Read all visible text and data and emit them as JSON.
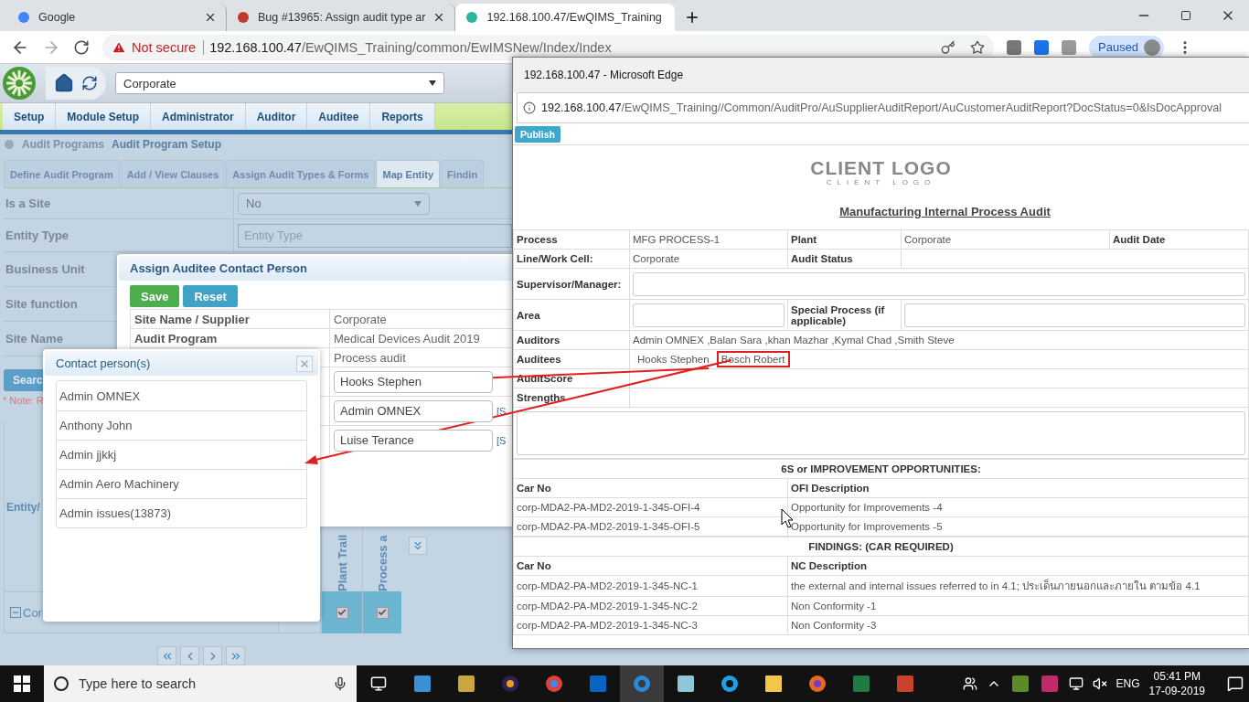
{
  "browser": {
    "tabs": [
      {
        "title": "Google",
        "selected": false
      },
      {
        "title": "Bug #13965: Assign audit type ar",
        "selected": false
      },
      {
        "title": "192.168.100.47/EwQIMS_Training",
        "selected": true
      }
    ],
    "address": {
      "security": "Not secure",
      "host": "192.168.100.47",
      "path": "/EwQIMS_Training/common/EwIMSNew/Index/Index"
    },
    "profile": "Paused"
  },
  "app": {
    "site_select": "Corporate",
    "menu": [
      "Setup",
      "Module Setup",
      "Administrator",
      "Auditor",
      "Auditee",
      "Reports"
    ],
    "breadcrumb": [
      "Audit Programs",
      "Audit Program Setup"
    ],
    "tabs": [
      {
        "label": "Define Audit Program",
        "selected": false
      },
      {
        "label": "Add / View Clauses",
        "selected": false
      },
      {
        "label": "Assign Audit Types & Forms",
        "selected": false
      },
      {
        "label": "Map Entity",
        "selected": true
      },
      {
        "label": "Findin",
        "selected": false
      }
    ],
    "form": [
      {
        "label": "Is a Site",
        "kind": "select",
        "value": "No"
      },
      {
        "label": "Entity Type",
        "kind": "input",
        "placeholder": "Entity Type"
      },
      {
        "label": "Business Unit",
        "kind": "empty"
      },
      {
        "label": "Site function",
        "kind": "empty"
      },
      {
        "label": "Site Name",
        "kind": "empty"
      }
    ],
    "search_button": "Searc",
    "note": "* Note: R",
    "entity_label": "Entity/",
    "grid": {
      "columns": [
        "Plant Trail",
        "Process a"
      ],
      "row": {
        "label": "Cor",
        "expanded": true,
        "checks": [
          true,
          true
        ]
      }
    }
  },
  "assign_dialog": {
    "title": "Assign Auditee Contact Person",
    "buttons": [
      "Save",
      "Reset"
    ],
    "rows": [
      {
        "label": "Site Name / Supplier",
        "value": "Corporate"
      },
      {
        "label": "Audit Program",
        "value": "Medical Devices Audit 2019"
      },
      {
        "value": "Process audit"
      }
    ],
    "contacts": [
      {
        "value": "Hooks Stephen"
      },
      {
        "value": "Admin OMNEX",
        "link": "[S"
      },
      {
        "value": "Luise Terance",
        "link": "[S"
      }
    ]
  },
  "contact_dialog": {
    "title": "Contact person(s)",
    "items": [
      "Admin OMNEX",
      "Anthony John",
      "Admin jjkkj",
      "Admin Aero Machinery",
      "Admin issues(13873)"
    ]
  },
  "edge": {
    "title": "192.168.100.47 - Microsoft Edge",
    "url_host": "192.168.100.47",
    "url_path": "/EwQIMS_Training//Common/AuditPro/AuSupplierAuditReport/AuCustomerAuditReport?DocStatus=0&IsDocApproval",
    "publish": "Publish",
    "logo": {
      "main": "CLIENT LOGO",
      "sub": "CLIENT LOGO"
    },
    "report_title": "Manufacturing Internal Process Audit",
    "report": {
      "process": {
        "label": "Process",
        "value": "MFG PROCESS-1"
      },
      "plant": {
        "label": "Plant",
        "value": "Corporate"
      },
      "audit_date": "Audit Date",
      "line": {
        "label": "Line/Work Cell:",
        "value": "Corporate"
      },
      "audit_status": "Audit Status",
      "supervisor": "Supervisor/Manager:",
      "area": "Area",
      "special_process": "Special Process (if applicable)",
      "auditors": {
        "label": "Auditors",
        "value": "Admin OMNEX ,Balan Sara ,khan Mazhar ,Kymal Chad ,Smith Steve"
      },
      "auditees": {
        "label": "Auditees",
        "names": [
          {
            "name": "Hooks Stephen",
            "highlighted": false
          },
          {
            "name": "Bosch Robert",
            "highlighted": true
          }
        ]
      },
      "audit_score": "AuditScore",
      "strengths": "Strengths"
    },
    "sections": [
      {
        "heading": "6S or IMPROVEMENT OPPORTUNITIES:",
        "columns": [
          "Car No",
          "OFI Description"
        ],
        "rows": [
          [
            "corp-MDA2-PA-MD2-2019-1-345-OFI-4",
            "Opportunity for Improvements -4"
          ],
          [
            "corp-MDA2-PA-MD2-2019-1-345-OFI-5",
            "Opportunity for Improvements -5"
          ]
        ]
      },
      {
        "heading": "FINDINGS: (CAR REQUIRED)",
        "columns": [
          "Car No",
          "NC Description"
        ],
        "rows": [
          [
            "corp-MDA2-PA-MD2-2019-1-345-NC-1",
            "the external and internal issues referred to in 4.1; ประเด็นภายนอกและภายใน ตามข้อ 4.1"
          ],
          [
            "corp-MDA2-PA-MD2-2019-1-345-NC-2",
            "Non Conformity -1"
          ],
          [
            "corp-MDA2-PA-MD2-2019-1-345-NC-3",
            "Non Conformity -3"
          ]
        ]
      }
    ]
  },
  "taskbar": {
    "search_placeholder": "Type here to search",
    "language": "ENG",
    "time": "05:41 PM",
    "date": "17-09-2019"
  }
}
